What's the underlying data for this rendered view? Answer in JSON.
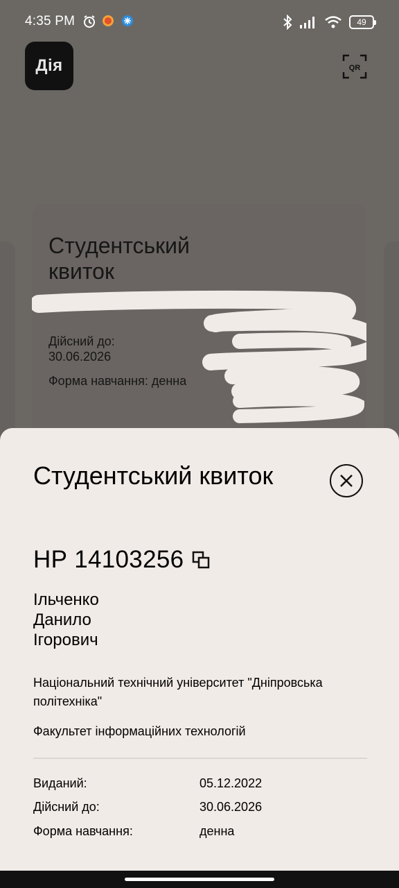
{
  "status_bar": {
    "time": "4:35 PM",
    "battery": "49",
    "icons": [
      "alarm-icon",
      "app-notification-icon",
      "app-notification-icon-2",
      "bluetooth-icon",
      "signal-icon",
      "wifi-icon",
      "battery-icon"
    ]
  },
  "app": {
    "logo": "Дія",
    "qr_label": "QR"
  },
  "background_card": {
    "title": "Студентський квиток",
    "valid_label": "Дійсний до:",
    "valid_date": "30.06.2026",
    "form": "Форма навчання: денна"
  },
  "sheet": {
    "title": "Студентський квиток",
    "ticket_number": "НР 14103256",
    "name_lines": [
      "Ільченко",
      "Данило",
      "Ігорович"
    ],
    "university": "Національний технічний університет \"Дніпровська політехніка\"",
    "faculty": "Факультет інформаційних технологій",
    "details": [
      {
        "label": "Виданий:",
        "value": "05.12.2022"
      },
      {
        "label": "Дійсний до:",
        "value": "30.06.2026"
      },
      {
        "label": "Форма навчання:",
        "value": "денна"
      }
    ]
  },
  "colors": {
    "background": "#6b6864",
    "sheet": "#f1ebe7",
    "logo_bg": "#111111"
  }
}
